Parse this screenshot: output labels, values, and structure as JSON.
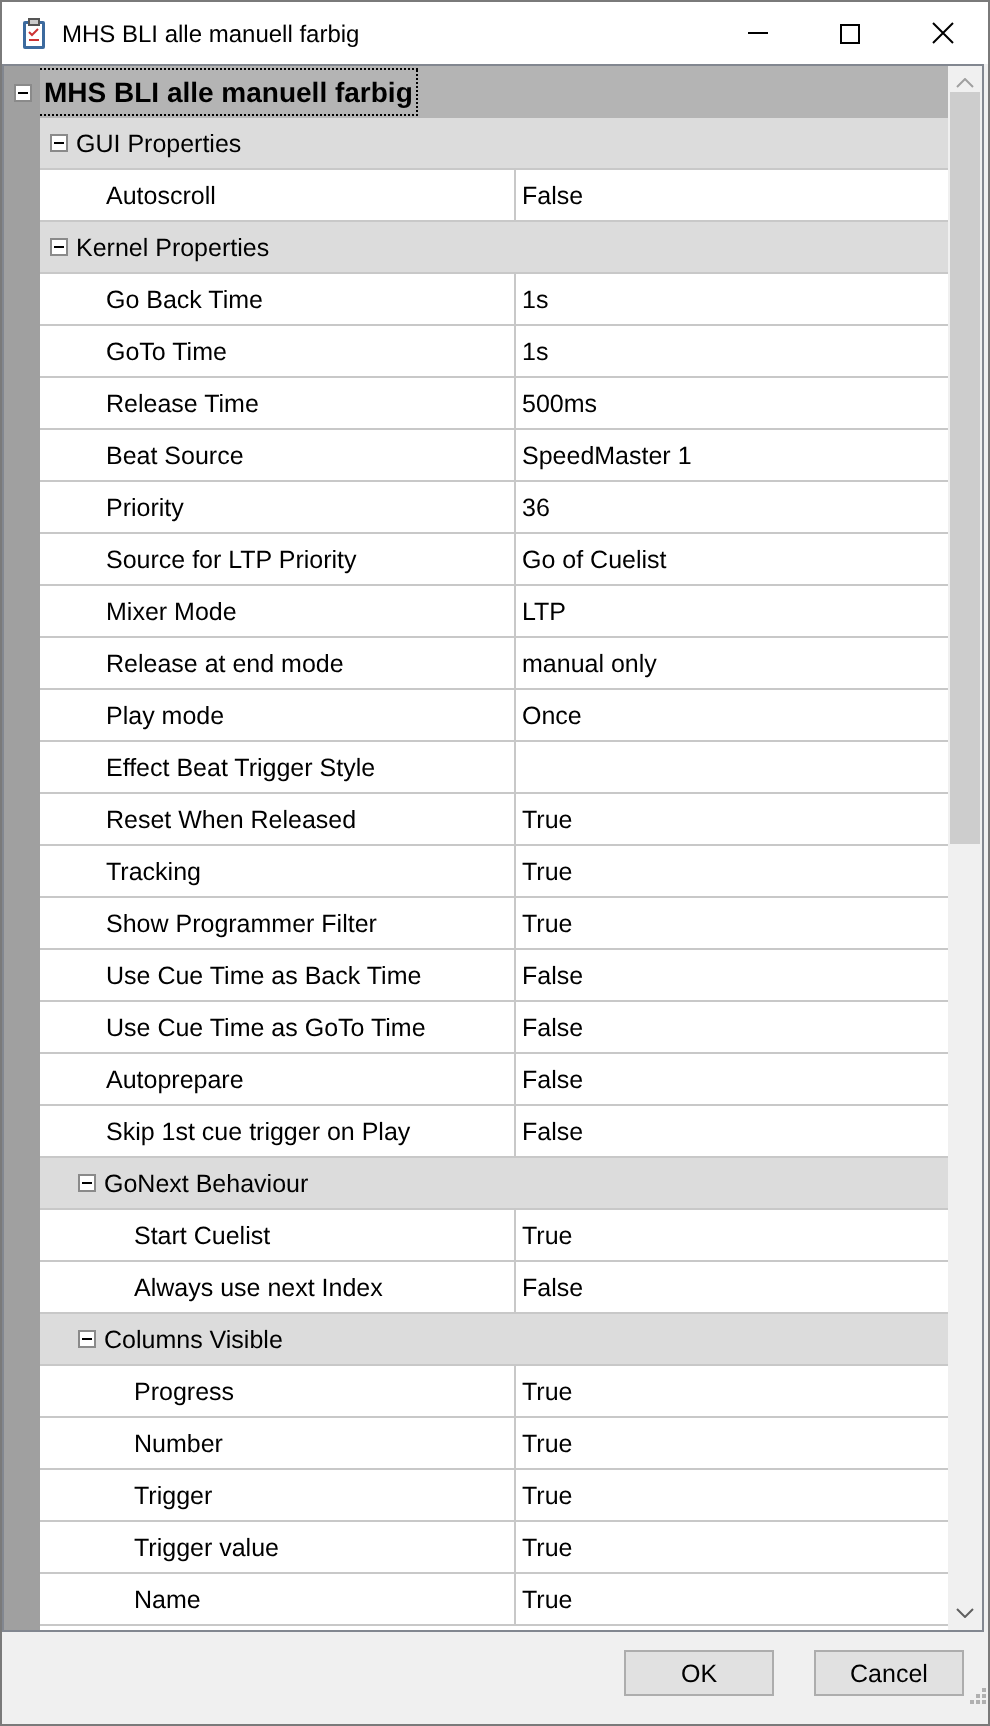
{
  "window": {
    "title": "MHS BLI alle manuell farbig"
  },
  "grid": {
    "root": {
      "label": "MHS BLI alle manuell farbig",
      "expanded": true,
      "focused": true,
      "children": [
        {
          "kind": "category",
          "label": "GUI Properties",
          "expanded": true,
          "children": [
            {
              "kind": "property",
              "name": "Autoscroll",
              "value": "False"
            }
          ]
        },
        {
          "kind": "category",
          "label": "Kernel Properties",
          "expanded": true,
          "children": [
            {
              "kind": "property",
              "name": "Go Back Time",
              "value": "1s"
            },
            {
              "kind": "property",
              "name": "GoTo Time",
              "value": "1s"
            },
            {
              "kind": "property",
              "name": "Release Time",
              "value": "500ms"
            },
            {
              "kind": "property",
              "name": "Beat Source",
              "value": "SpeedMaster 1"
            },
            {
              "kind": "property",
              "name": "Priority",
              "value": "36"
            },
            {
              "kind": "property",
              "name": "Source for LTP Priority",
              "value": "Go of Cuelist"
            },
            {
              "kind": "property",
              "name": "Mixer Mode",
              "value": "LTP"
            },
            {
              "kind": "property",
              "name": "Release at end mode",
              "value": "manual only"
            },
            {
              "kind": "property",
              "name": "Play mode",
              "value": "Once"
            },
            {
              "kind": "property",
              "name": "Effect Beat Trigger Style"
            },
            {
              "kind": "property",
              "name": "Reset When Released",
              "value": "True"
            },
            {
              "kind": "property",
              "name": "Tracking",
              "value": "True"
            },
            {
              "kind": "property",
              "name": "Show Programmer Filter",
              "value": "True"
            },
            {
              "kind": "property",
              "name": "Use Cue Time as Back Time",
              "value": "False"
            },
            {
              "kind": "property",
              "name": "Use Cue Time as GoTo Time",
              "value": "False"
            },
            {
              "kind": "property",
              "name": "Autoprepare",
              "value": "False"
            },
            {
              "kind": "property",
              "name": "Skip 1st cue trigger on Play",
              "value": "False"
            },
            {
              "kind": "category",
              "label": "GoNext Behaviour",
              "expanded": true,
              "children": [
                {
                  "kind": "property",
                  "name": "Start Cuelist",
                  "value": "True"
                },
                {
                  "kind": "property",
                  "name": "Always use next Index",
                  "value": "False"
                }
              ]
            },
            {
              "kind": "category",
              "label": "Columns Visible",
              "expanded": true,
              "children": [
                {
                  "kind": "property",
                  "name": "Progress",
                  "value": "True"
                },
                {
                  "kind": "property",
                  "name": "Number",
                  "value": "True"
                },
                {
                  "kind": "property",
                  "name": "Trigger",
                  "value": "True"
                },
                {
                  "kind": "property",
                  "name": "Trigger value",
                  "value": "True"
                },
                {
                  "kind": "property",
                  "name": "Name",
                  "value": "True"
                }
              ]
            }
          ]
        }
      ]
    }
  },
  "buttons": [
    "OK",
    "Cancel"
  ]
}
